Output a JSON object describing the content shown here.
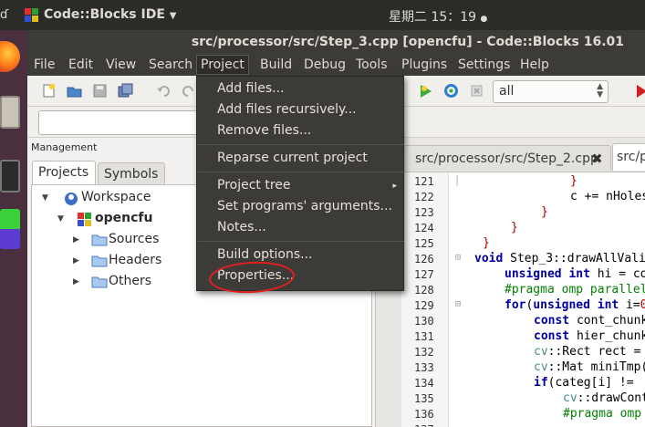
{
  "topbar": {
    "edge_text": "ɗ",
    "app_name": "Code::Blocks IDE",
    "app_menu_arrow": "▼",
    "clock": "星期二 15：19",
    "status_dot": "●"
  },
  "window": {
    "title": "src/processor/src/Step_3.cpp [opencfu] - Code::Blocks 16.01"
  },
  "menubar": {
    "items": [
      "File",
      "Edit",
      "View",
      "Search",
      "Project",
      "Build",
      "Debug",
      "Tools",
      "Plugins",
      "Settings",
      "Help"
    ],
    "active": "Project"
  },
  "toolbar": {
    "build_target": "all"
  },
  "project_menu": {
    "items": [
      "Add files...",
      "Add files recursively...",
      "Remove files...",
      "Reparse current project",
      "Project tree",
      "Set programs' arguments...",
      "Notes...",
      "Build options...",
      "Properties..."
    ],
    "submenu_arrow": "▸"
  },
  "management": {
    "header": "Management",
    "tabs": [
      "Projects",
      "Symbols"
    ],
    "tree": {
      "workspace": "Workspace",
      "project": "opencfu",
      "folders": [
        "Sources",
        "Headers",
        "Others"
      ]
    }
  },
  "editor": {
    "tabs": [
      "src/processor/src/Step_2.cpp",
      "src/p"
    ],
    "close_glyph": "✖",
    "line_numbers": [
      "121",
      "122",
      "123",
      "124",
      "125",
      "126",
      "127",
      "128",
      "129",
      "130",
      "131",
      "132",
      "133",
      "134",
      "135",
      "136",
      "137"
    ]
  },
  "colors": {
    "menu_bg": "#3c3b37",
    "launcher_bg": "#4a2f3e",
    "annotation_red": "#e02020",
    "keyword_blue": "#0000a0",
    "preproc_green": "#008000"
  }
}
